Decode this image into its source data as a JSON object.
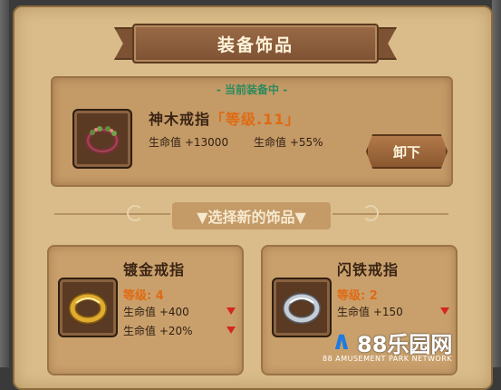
{
  "title": "装备饰品",
  "current": {
    "tag": "- 当前装备中 -",
    "name": "神木戒指",
    "level_text": "「等级.11」",
    "stat_hp_label": "生命值",
    "stat_hp_value": "+13000",
    "stat_hp2_label": "生命值",
    "stat_hp2_value": "+55%",
    "unequip_label": "卸下"
  },
  "divider_text": "▼选择新的饰品▼",
  "options": [
    {
      "name": "镀金戒指",
      "level": "等级: 4",
      "stat1": "生命值 +400",
      "stat2": "生命值 +20%",
      "ring_color": "#d8a126"
    },
    {
      "name": "闪铁戒指",
      "level": "等级: 2",
      "stat1": "生命值 +150",
      "ring_color": "#b9c0c8"
    }
  ],
  "watermark": {
    "logo": "∧",
    "text": "88乐园网",
    "sub": "88 AMUSEMENT PARK NETWORK"
  },
  "colors": {
    "level_orange": "#e06a12",
    "current_green": "#2c8a5c",
    "arrow_red": "#d4271d"
  }
}
